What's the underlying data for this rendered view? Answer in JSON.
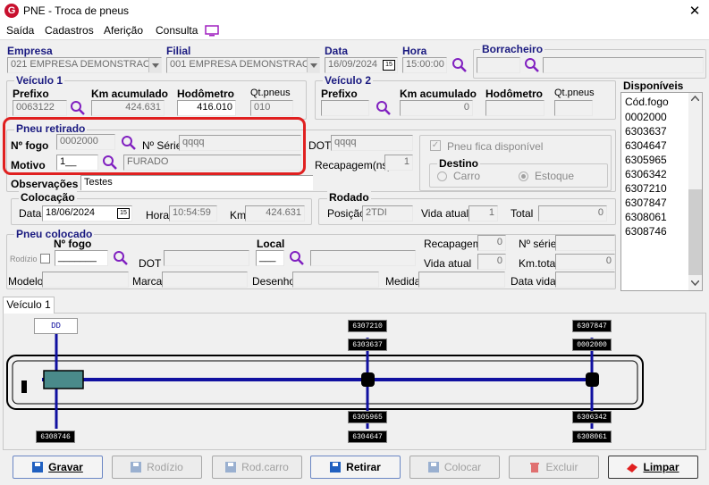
{
  "window": {
    "title": "PNE - Troca de pneus",
    "close": "✕"
  },
  "menu": [
    "Saída",
    "Cadastros",
    "Aferição",
    "Consulta"
  ],
  "header": {
    "empresa_label": "Empresa",
    "empresa": "021 EMPRESA DEMONSTRAC",
    "filial_label": "Filial",
    "filial": "001 EMPRESA DEMONSTRAC",
    "data_label": "Data",
    "data": "16/09/2024",
    "hora_label": "Hora",
    "hora": "15:00:00",
    "borracheiro_label": "Borracheiro",
    "borracheiro_code": "",
    "borracheiro_name": ""
  },
  "veiculo1": {
    "title": "Veículo 1",
    "prefixo_label": "Prefixo",
    "prefixo": "0063122",
    "km_label": "Km acumulado",
    "km": "424.631",
    "hod_label": "Hodômetro",
    "hod": "416.010",
    "qt_label": "Qt.pneus",
    "qt": "010"
  },
  "veiculo2": {
    "title": "Veículo 2",
    "prefixo_label": "Prefixo",
    "prefixo": "",
    "km_label": "Km acumulado",
    "km": "0",
    "hod_label": "Hodômetro",
    "hod": "",
    "qt_label": "Qt.pneus",
    "qt": ""
  },
  "disponiveis": {
    "title": "Disponíveis",
    "header": "Cód.fogo",
    "items": [
      "0002000",
      "6303637",
      "6304647",
      "6305965",
      "6306342",
      "6307210",
      "6307847",
      "6308061",
      "6308746"
    ]
  },
  "pneu_retirado": {
    "title": "Pneu retirado",
    "nfogo_label": "Nº fogo",
    "nfogo": "0002000",
    "nserie_label": "Nº Série",
    "nserie": "qqqq",
    "dot_label": "DOT",
    "dot": "qqqq",
    "motivo_label": "Motivo",
    "motivo_code": "1__",
    "motivo": "FURADO",
    "recap_label": "Recapagem(ns)",
    "recap": "1",
    "fica_disp": "Pneu fica disponível",
    "destino_title": "Destino",
    "destino_carro": "Carro",
    "destino_estoque": "Estoque"
  },
  "observacoes": {
    "label": "Observações",
    "value": "Testes"
  },
  "colocacao": {
    "title": "Colocação",
    "data_label": "Data",
    "data": "18/06/2024",
    "hora_label": "Hora",
    "hora": "10:54:59",
    "km_label": "Km",
    "km": "424.631"
  },
  "rodado": {
    "title": "Rodado",
    "posicao_label": "Posição",
    "posicao": "2TDI",
    "vida_label": "Vida atual",
    "vida": "1",
    "total_label": "Total",
    "total": "0"
  },
  "pneu_colocado": {
    "title": "Pneu colocado",
    "nfogo_label": "Nº fogo",
    "nfogo": "_______",
    "local_label": "Local",
    "local": "___",
    "rodizio_label": "Rodízio",
    "dot_label": "DOT",
    "recap_label": "Recapagem",
    "recap": "0",
    "nserie_label": "Nº série",
    "vida_label": "Vida atual",
    "vida": "0",
    "kmtotal_label": "Km.total",
    "kmtotal": "0",
    "modelo_label": "Modelo",
    "marca_label": "Marca",
    "desenho_label": "Desenho",
    "medida_label": "Medida",
    "datavida_label": "Data vida"
  },
  "tabs": [
    "Veículo 1"
  ],
  "diagram": {
    "dd": "DD",
    "tags": {
      "a_top_far": "6307210",
      "a_top_near": "6303637",
      "a_bot_near": "6305965",
      "a_bot_far": "6304647",
      "b_top_far": "6307847",
      "b_top_near": "0002000",
      "b_bot_near": "6306342",
      "b_bot_far": "6308061",
      "front_bot": "6308746"
    }
  },
  "buttons": {
    "gravar": "Gravar",
    "rodizio": "Rodízio",
    "rodcarro": "Rod.carro",
    "retirar": "Retirar",
    "colocar": "Colocar",
    "excluir": "Excluir",
    "limpar": "Limpar"
  },
  "colors": {
    "accent_blue": "#1a1a80",
    "highlight_red": "#e02020",
    "axle_blue": "#1010a0"
  }
}
